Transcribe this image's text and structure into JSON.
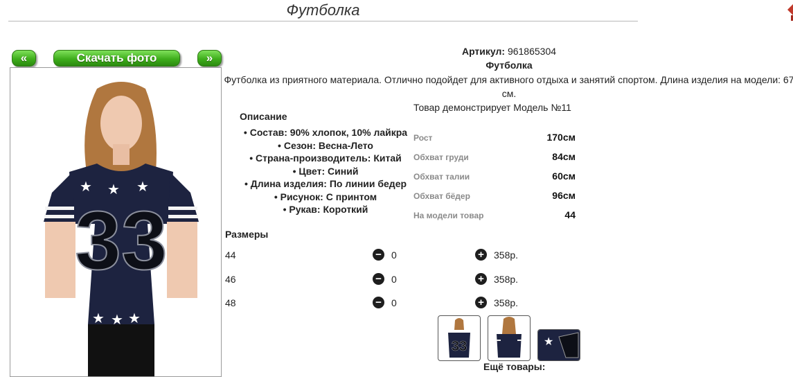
{
  "page": {
    "title": "Футболка"
  },
  "nav": {
    "prev_label": "«",
    "download_label": "Скачать фото",
    "next_label": "»"
  },
  "product": {
    "article_label": "Артикул:",
    "article_value": "961865304",
    "name": "Футболка",
    "description": "Футболка из приятного материала. Отлично подойдет для активного отдыха и занятий спортом. Длина изделия на модели: 67 см."
  },
  "description_block": {
    "heading": "Описание",
    "items": [
      "Состав: 90% хлопок, 10% лайкра",
      "Сезон: Весна-Лето",
      "Страна-производитель: Китай",
      "Цвет: Синий",
      "Длина изделия: По линии бедер",
      "Рисунок: С принтом",
      "Рукав: Короткий"
    ]
  },
  "model": {
    "heading": "Товар демонстрирует Модель №11",
    "params": [
      {
        "label": "Рост",
        "value": "170см"
      },
      {
        "label": "Обхват груди",
        "value": "84см"
      },
      {
        "label": "Обхват талии",
        "value": "60см"
      },
      {
        "label": "Обхват бёдер",
        "value": "96см"
      },
      {
        "label": "На модели товар",
        "value": "44"
      }
    ]
  },
  "sizes": {
    "heading": "Размеры",
    "rows": [
      {
        "size": "44",
        "qty": "0",
        "price": "358р."
      },
      {
        "size": "46",
        "qty": "0",
        "price": "358р."
      },
      {
        "size": "48",
        "qty": "0",
        "price": "358р."
      }
    ],
    "minus_icon": "minus-circle-icon",
    "plus_icon": "plus-circle-icon"
  },
  "more_label": "Ещё товары:",
  "colors": {
    "button_green": "#3fae1c",
    "tshirt_navy": "#1d2340"
  }
}
